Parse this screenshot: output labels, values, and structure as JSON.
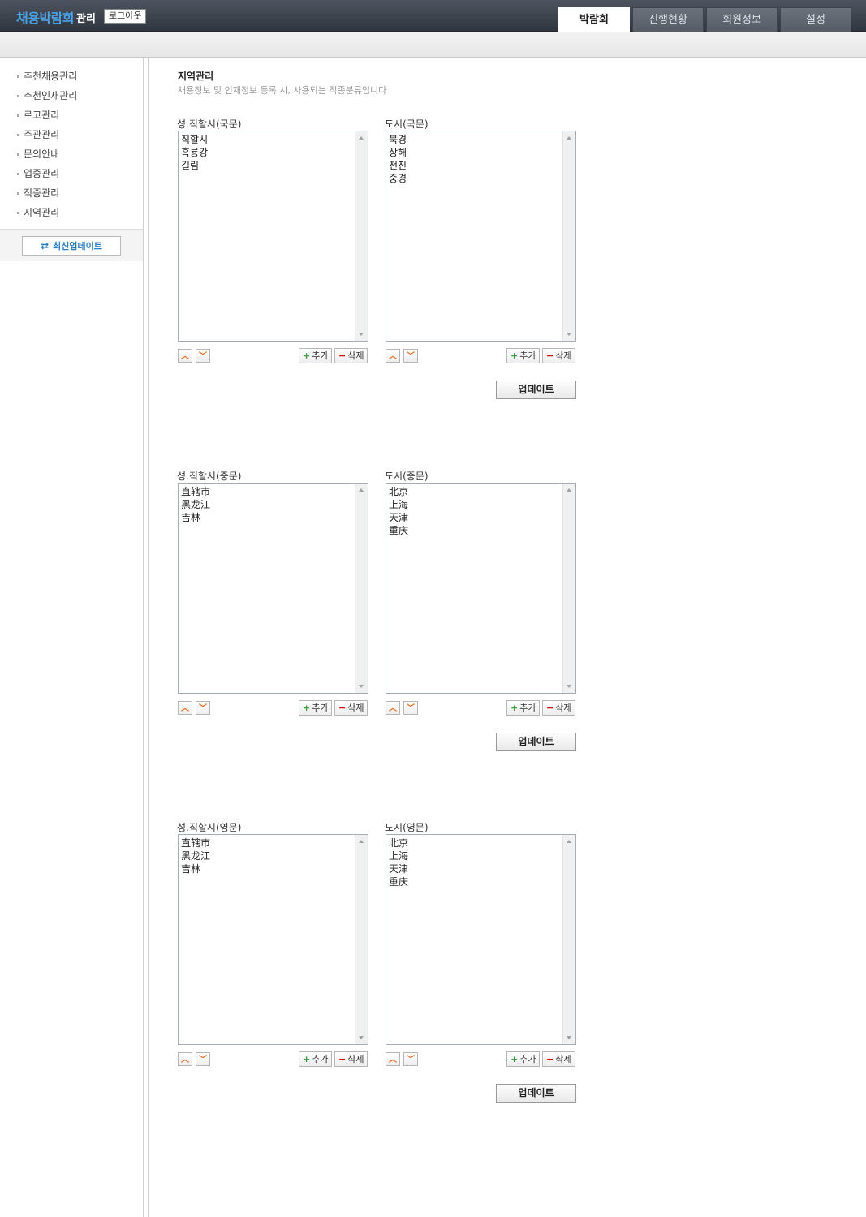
{
  "header": {
    "brand": "채용박람회",
    "brand_sub": "관리",
    "logout_label": "로그아웃",
    "tabs": [
      {
        "label": "박람회",
        "active": true
      },
      {
        "label": "진행현황",
        "active": false
      },
      {
        "label": "회원정보",
        "active": false
      },
      {
        "label": "설정",
        "active": false
      }
    ]
  },
  "sidebar": {
    "items": [
      {
        "label": "추천채용관리"
      },
      {
        "label": "추천인재관리"
      },
      {
        "label": "로고관리"
      },
      {
        "label": "주관관리"
      },
      {
        "label": "문의안내"
      },
      {
        "label": "업종관리"
      },
      {
        "label": "직종관리"
      },
      {
        "label": "지역관리"
      }
    ],
    "update_latest_label": "최신업데이트",
    "update_latest_icon": "refresh-icon"
  },
  "page": {
    "title": "지역관리",
    "description": "채용정보 및 인재정보 등록 시, 사용되는 직종분류입니다"
  },
  "controls": {
    "add_label": "추가",
    "delete_label": "삭제",
    "update_label": "업데이트",
    "up_icon": "chevron-up-icon",
    "down_icon": "chevron-down-icon"
  },
  "sections": [
    {
      "left": {
        "label": "성.직할시(국문)",
        "items": [
          "직할시",
          "흑룡강",
          "길림"
        ]
      },
      "right": {
        "label": "도시(국문)",
        "items": [
          "북경",
          "상해",
          "천진",
          "중경"
        ]
      }
    },
    {
      "left": {
        "label": "성.직할시(중문)",
        "items": [
          "直辖市",
          "黑龙江",
          "吉林"
        ]
      },
      "right": {
        "label": "도시(중문)",
        "items": [
          "北京",
          "上海",
          "天津",
          "重庆"
        ]
      }
    },
    {
      "left": {
        "label": "성.직할시(영문)",
        "items": [
          "直辖市",
          "黑龙江",
          "吉林"
        ]
      },
      "right": {
        "label": "도시(영문)",
        "items": [
          "北京",
          "上海",
          "天津",
          "重庆"
        ]
      }
    }
  ],
  "colors": {
    "brand": "#4aa3e8",
    "arrow_accent": "#e8661c",
    "add_accent": "#3aa23a",
    "delete_accent": "#dd1111"
  }
}
